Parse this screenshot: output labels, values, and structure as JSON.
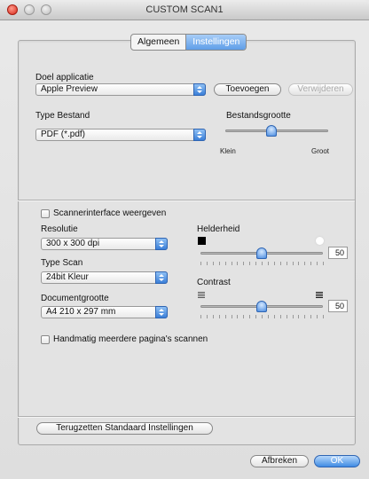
{
  "window": {
    "title": "CUSTOM SCAN1"
  },
  "tabs": [
    {
      "label": "Algemeen",
      "active": false
    },
    {
      "label": "Instellingen",
      "active": true
    }
  ],
  "app": {
    "label": "Doel applicatie",
    "value": "Apple Preview",
    "add_label": "Toevoegen",
    "remove_label": "Verwijderen"
  },
  "filetype": {
    "label": "Type Bestand",
    "value": "PDF (*.pdf)"
  },
  "filesize": {
    "label": "Bestandsgrootte",
    "min_label": "Klein",
    "max_label": "Groot",
    "value_fraction": 0.45
  },
  "scanner_interface": {
    "label": "Scannerinterface weergeven",
    "checked": false
  },
  "resolution": {
    "label": "Resolutie",
    "value": "300 x 300 dpi"
  },
  "scan_type": {
    "label": "Type Scan",
    "value": "24bit Kleur"
  },
  "doc_size": {
    "label": "Documentgrootte",
    "value": "A4  210 x 297 mm"
  },
  "brightness": {
    "label": "Helderheid",
    "value": "50",
    "fraction": 0.5
  },
  "contrast": {
    "label": "Contrast",
    "value": "50",
    "fraction": 0.5
  },
  "manual_multi": {
    "label": "Handmatig meerdere pagina's scannen",
    "checked": false
  },
  "reset_label": "Terugzetten Standaard Instellingen",
  "footer": {
    "cancel_label": "Afbreken",
    "ok_label": "OK"
  },
  "colors": {
    "accent": "#3f8be3"
  }
}
